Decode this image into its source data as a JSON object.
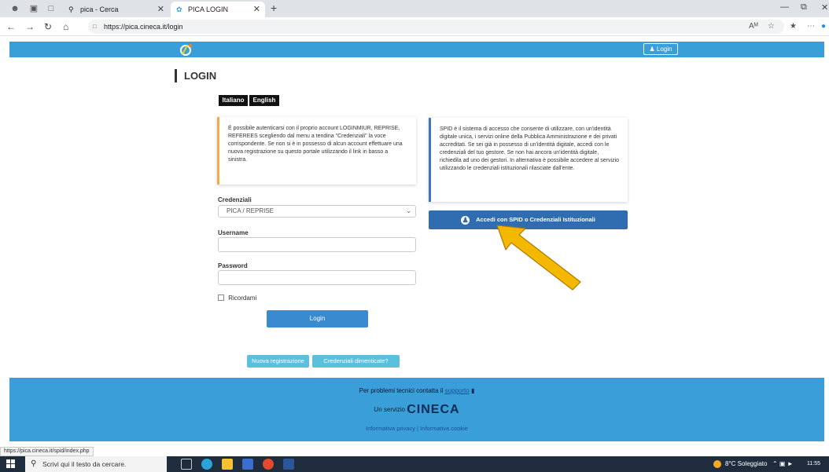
{
  "browser": {
    "tabs": [
      {
        "label": "pica - Cerca",
        "active": false
      },
      {
        "label": "PICA LOGIN",
        "active": true
      }
    ],
    "url": "https://pica.cineca.it/login"
  },
  "nav": {
    "login_label": "Login"
  },
  "page": {
    "title": "LOGIN"
  },
  "languages": [
    "Italiano",
    "English"
  ],
  "left_info": "È possibile autenticarsi con il proprio account LOGINMIUR, REPRISE, REFEREES scegliendo dal menu a tendina \"Credenziali\" la voce corrispondente. Se non si è in possesso di alcun account effettuare una nuova registrazione su questo portale utilizzando il link in basso a sinistra.",
  "right_info": "SPID è il sistema di accesso che consente di utilizzare, con un'identità digitale unica, i servizi online della Pubblica Amministrazione e dei privati accreditati. Se sei già in possesso di un'identità digitale, accedi con le credenziali del tuo gestore. Se non hai ancora un'identità digitale, richiedila ad uno dei gestori. In alternativa è possibile accedere al servizio utilizzando le credenziali istituzionali rilasciate dall'ente.",
  "form": {
    "credentials_label": "Credenziali",
    "credentials_value": "PICA / REPRISE",
    "username_label": "Username",
    "password_label": "Password",
    "remember_label": "Ricordami",
    "login_button": "Login"
  },
  "spid_button": "Accedi con SPID o Credenziali Istituzionali",
  "links": {
    "register": "Nuova registrazione",
    "forgot": "Credenziali dimenticate?"
  },
  "footer": {
    "support_prefix": "Per problemi tecnici contatta il",
    "support_link": "supporto",
    "service_prefix": "Un servizio",
    "brand": "CINECA",
    "privacy": "Informativa privacy",
    "separator": "|",
    "cookie": "Informativa cookie"
  },
  "status_url": "https://pica.cineca.it/spid/index.php",
  "taskbar": {
    "search_placeholder": "Scrivi qui il testo da cercare.",
    "weather": "8°C Soleggiato",
    "time": "11:55"
  },
  "colors": {
    "brand_blue": "#3a9fd8",
    "spid_blue": "#2f6db0",
    "arrow": "#f5b800",
    "info_accent_left": "#f0ad4e",
    "info_accent_right": "#3a77c0"
  }
}
